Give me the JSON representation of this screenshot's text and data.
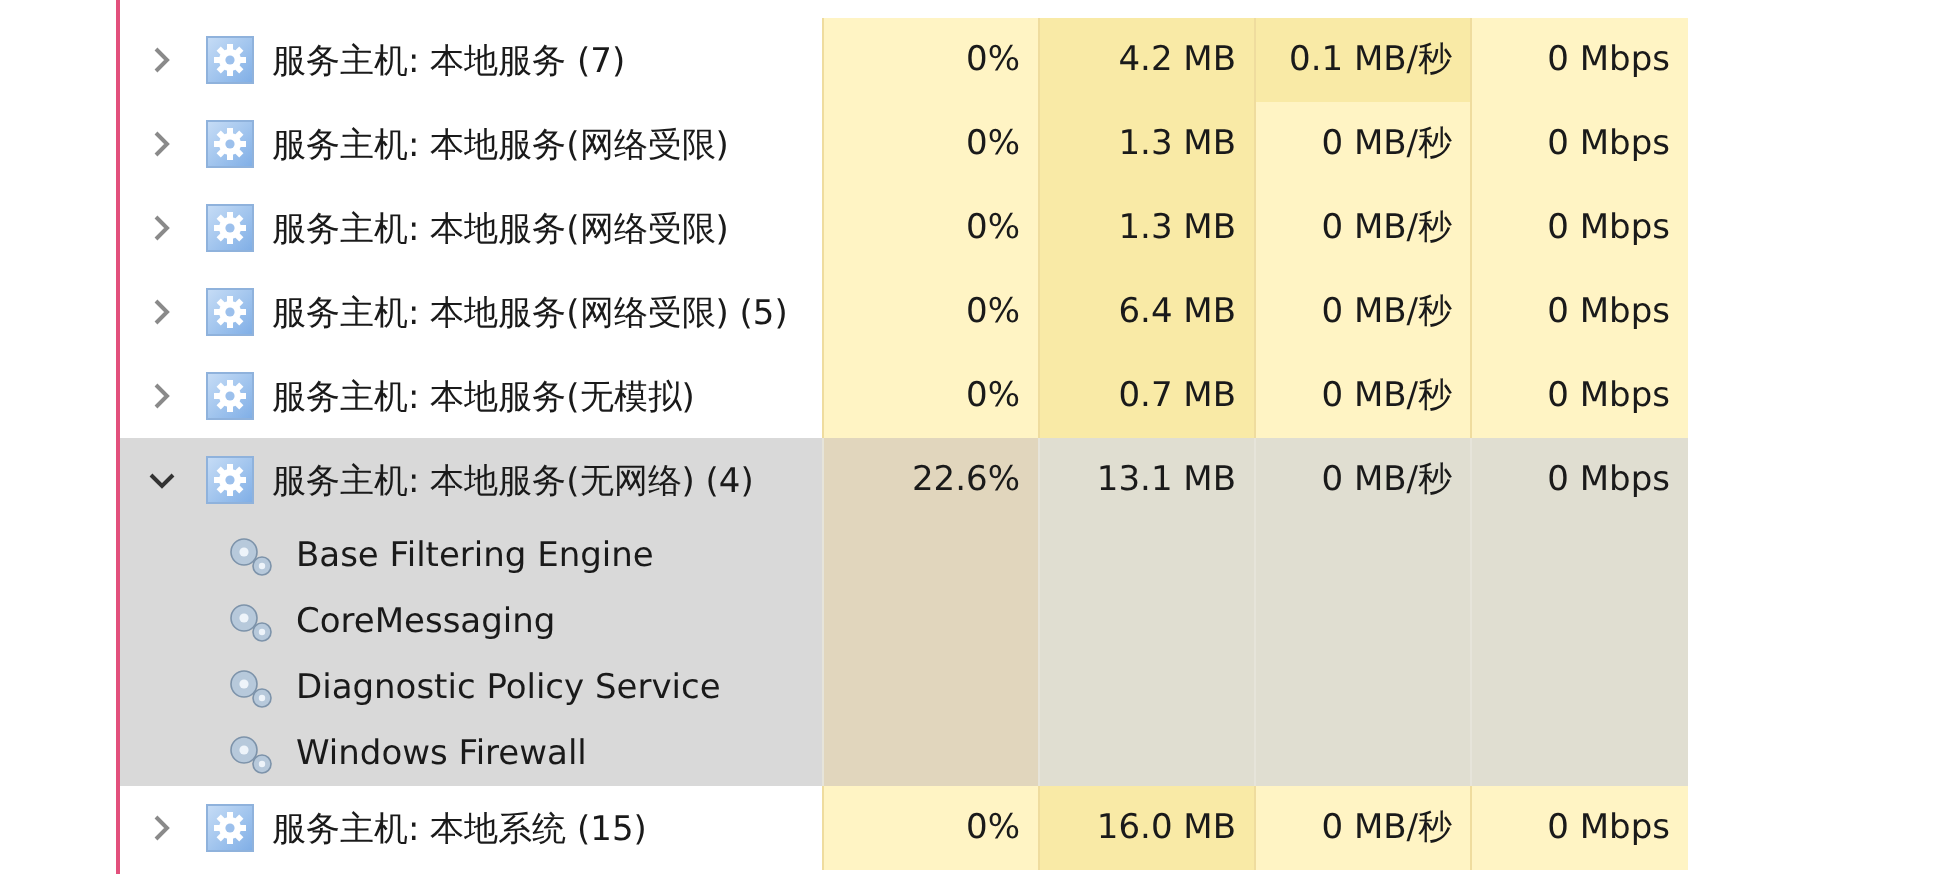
{
  "processes": [
    {
      "name": "服务主机: 本地服务 (7)",
      "expanded": false,
      "selected": false,
      "cells": [
        {
          "text": "0%",
          "color": "#fff4c4"
        },
        {
          "text": "4.2 MB",
          "color": "#f9eaa6"
        },
        {
          "text": "0.1 MB/秒",
          "color": "#f9eaa6"
        },
        {
          "text": "0 Mbps",
          "color": "#fff4c4"
        }
      ]
    },
    {
      "name": "服务主机: 本地服务(网络受限)",
      "expanded": false,
      "selected": false,
      "cells": [
        {
          "text": "0%",
          "color": "#fff4c4"
        },
        {
          "text": "1.3 MB",
          "color": "#f9eaa6"
        },
        {
          "text": "0 MB/秒",
          "color": "#fff4c4"
        },
        {
          "text": "0 Mbps",
          "color": "#fff4c4"
        }
      ]
    },
    {
      "name": "服务主机: 本地服务(网络受限)",
      "expanded": false,
      "selected": false,
      "cells": [
        {
          "text": "0%",
          "color": "#fff4c4"
        },
        {
          "text": "1.3 MB",
          "color": "#f9eaa6"
        },
        {
          "text": "0 MB/秒",
          "color": "#fff4c4"
        },
        {
          "text": "0 Mbps",
          "color": "#fff4c4"
        }
      ]
    },
    {
      "name": "服务主机: 本地服务(网络受限) (5)",
      "expanded": false,
      "selected": false,
      "cells": [
        {
          "text": "0%",
          "color": "#fff4c4"
        },
        {
          "text": "6.4 MB",
          "color": "#f9eaa6"
        },
        {
          "text": "0 MB/秒",
          "color": "#fff4c4"
        },
        {
          "text": "0 Mbps",
          "color": "#fff4c4"
        }
      ]
    },
    {
      "name": "服务主机: 本地服务(无模拟)",
      "expanded": false,
      "selected": false,
      "cells": [
        {
          "text": "0%",
          "color": "#fff4c4"
        },
        {
          "text": "0.7 MB",
          "color": "#f9eaa6"
        },
        {
          "text": "0 MB/秒",
          "color": "#fff4c4"
        },
        {
          "text": "0 Mbps",
          "color": "#fff4c4"
        }
      ]
    },
    {
      "name": "服务主机: 本地服务(无网络) (4)",
      "expanded": true,
      "selected": true,
      "cells": [
        {
          "text": "22.6%",
          "color": "#e1d6bd"
        },
        {
          "text": "13.1 MB",
          "color": "#e0ded1"
        },
        {
          "text": "0 MB/秒",
          "color": "#e0ded1"
        },
        {
          "text": "0 Mbps",
          "color": "#e0ded1"
        }
      ],
      "children": [
        {
          "name": "Base Filtering Engine"
        },
        {
          "name": "CoreMessaging"
        },
        {
          "name": "Diagnostic Policy Service"
        },
        {
          "name": "Windows Firewall"
        }
      ]
    },
    {
      "name": "服务主机: 本地系统 (15)",
      "expanded": false,
      "selected": false,
      "cells": [
        {
          "text": "0%",
          "color": "#fff4c4"
        },
        {
          "text": "16.0 MB",
          "color": "#f9eaa6"
        },
        {
          "text": "0 MB/秒",
          "color": "#fff4c4"
        },
        {
          "text": "0 Mbps",
          "color": "#fff4c4"
        }
      ]
    }
  ]
}
